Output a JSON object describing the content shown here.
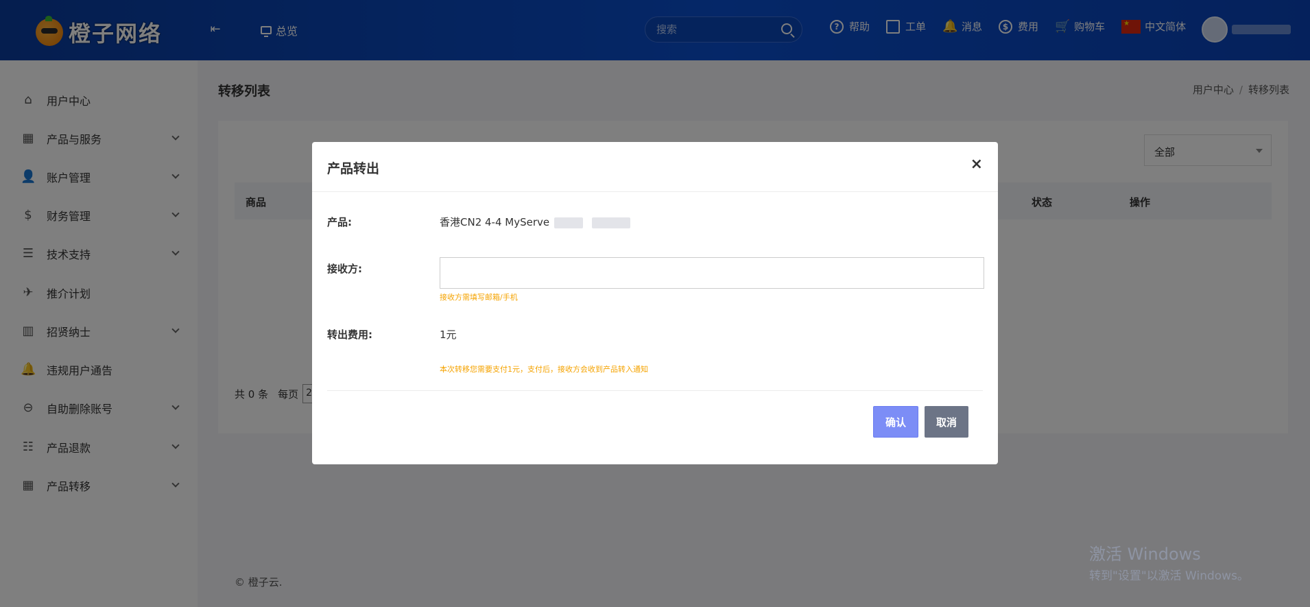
{
  "header": {
    "logo_text": "橙子网络",
    "overview": "总览",
    "search_placeholder": "搜索",
    "actions": [
      "帮助",
      "工单",
      "消息",
      "费用",
      "购物车"
    ],
    "language": "中文简体"
  },
  "sidebar": {
    "items": [
      {
        "label": "用户中心",
        "icon": "home-icon",
        "has_chevron": false
      },
      {
        "label": "产品与服务",
        "icon": "grid-icon",
        "has_chevron": true
      },
      {
        "label": "账户管理",
        "icon": "user-icon",
        "has_chevron": true
      },
      {
        "label": "财务管理",
        "icon": "dollar-icon",
        "has_chevron": true
      },
      {
        "label": "技术支持",
        "icon": "document-icon",
        "has_chevron": true
      },
      {
        "label": "推介计划",
        "icon": "paper-plane-icon",
        "has_chevron": false
      },
      {
        "label": "招贤纳士",
        "icon": "bar-chart-icon",
        "has_chevron": true
      },
      {
        "label": "违规用户通告",
        "icon": "bell-icon",
        "has_chevron": false
      },
      {
        "label": "自助删除账号",
        "icon": "minus-circle-icon",
        "has_chevron": true
      },
      {
        "label": "产品退款",
        "icon": "sliders-icon",
        "has_chevron": true
      },
      {
        "label": "产品转移",
        "icon": "grid-icon",
        "has_chevron": true
      }
    ]
  },
  "main": {
    "page_title": "转移列表",
    "breadcrumb": [
      "用户中心",
      "转移列表"
    ],
    "filter_selected": "全部",
    "table_headers": [
      "商品",
      "状态",
      "操作"
    ],
    "pager": {
      "total": "共 0 条",
      "per_page": "每页",
      "per_page_value": "2"
    },
    "footer": "© 橙子云."
  },
  "modal": {
    "title": "产品转出",
    "close": "×",
    "product_label": "产品:",
    "product_value": "香港CN2 4-4 MyServe",
    "receiver_label": "接收方:",
    "receiver_value": "",
    "receiver_hint": "接收方需填写邮箱/手机",
    "fee_label": "转出费用:",
    "fee_value": "1元",
    "fee_hint": "本次转移您需要支付1元，支付后，接收方会收到产品转入通知",
    "confirm": "确认",
    "cancel": "取消"
  },
  "watermark": {
    "line1": "激活 Windows",
    "line2": "转到\"设置\"以激活 Windows。"
  },
  "colors": {
    "header_bg": "#0b4fd0",
    "confirm_btn": "#7c8df6",
    "cancel_btn": "#6c7486",
    "hint": "#f5a300"
  }
}
